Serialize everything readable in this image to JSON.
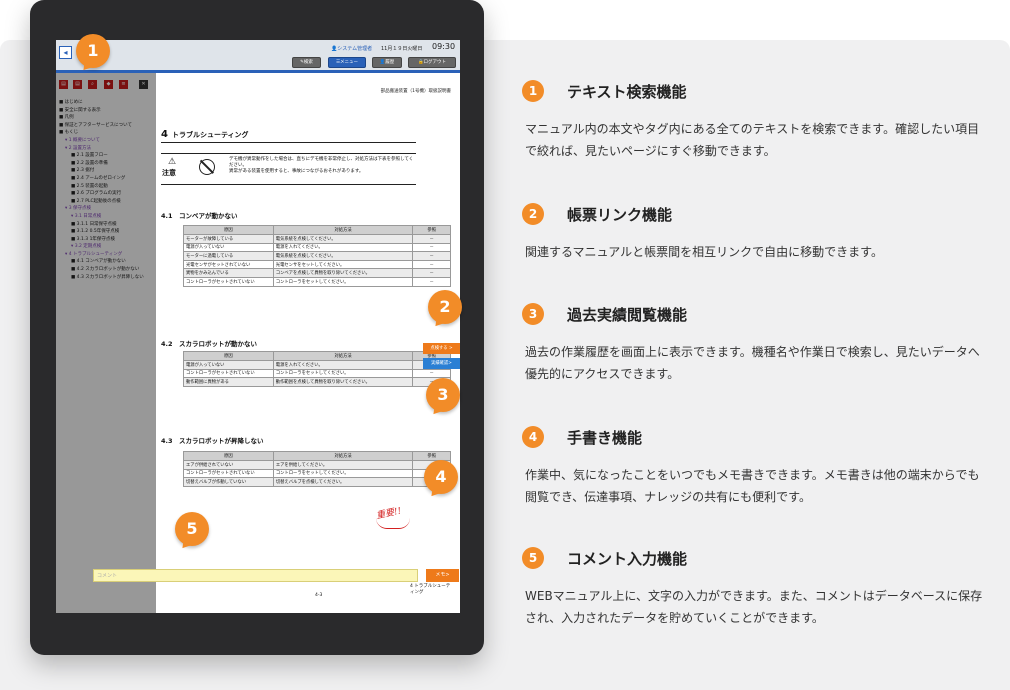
{
  "app": {
    "user": "システム管理者",
    "date": "11月１９日火曜日",
    "time": "09:30",
    "buttons": [
      "検索",
      "メニュー",
      "履歴",
      "ログアウト"
    ]
  },
  "sidebar": {
    "tools": [
      "document-icon",
      "document-icon",
      "search-icon",
      "tag-icon",
      "list-icon",
      "close-icon"
    ],
    "nav": [
      {
        "label": "はじめに",
        "level": 1,
        "purple": false
      },
      {
        "label": "安全に関する表示",
        "level": 1,
        "purple": false
      },
      {
        "label": "凡例",
        "level": 1,
        "purple": false
      },
      {
        "label": "保証とアフターサービスについて",
        "level": 1,
        "purple": false
      },
      {
        "label": "もくじ",
        "level": 1,
        "purple": false
      },
      {
        "label": "1 概要について",
        "level": 2,
        "purple": true
      },
      {
        "label": "2 設置方法",
        "level": 2,
        "purple": true
      },
      {
        "label": "2.1 設置フロー",
        "level": 3,
        "purple": false
      },
      {
        "label": "2.2 設置の準備",
        "level": 3,
        "purple": false
      },
      {
        "label": "2.3 据付",
        "level": 3,
        "purple": false
      },
      {
        "label": "2.4 アームのゼロイング",
        "level": 3,
        "purple": false
      },
      {
        "label": "2.5 装置の起動",
        "level": 3,
        "purple": false
      },
      {
        "label": "2.6 プログラムの実行",
        "level": 3,
        "purple": false
      },
      {
        "label": "2.7 PLC起動後の点検",
        "level": 3,
        "purple": false
      },
      {
        "label": "3 保守点検",
        "level": 2,
        "purple": true
      },
      {
        "label": "3.1 日常点検",
        "level": 3,
        "purple": true
      },
      {
        "label": "3.1.1 日常保守点検",
        "level": 3,
        "purple": false
      },
      {
        "label": "3.1.2 0.5年保守点検",
        "level": 3,
        "purple": false
      },
      {
        "label": "3.1.3 1年保守点検",
        "level": 3,
        "purple": false
      },
      {
        "label": "3.2 定期点検",
        "level": 3,
        "purple": true
      },
      {
        "label": "4 トラブルシューティング",
        "level": 2,
        "purple": true
      },
      {
        "label": "4.1 コンベアが動かない",
        "level": 3,
        "purple": false
      },
      {
        "label": "4.2 スカラロボットが動かない",
        "level": 3,
        "purple": false
      },
      {
        "label": "4.3 スカラロボットが昇降しない",
        "level": 3,
        "purple": false
      }
    ]
  },
  "doc": {
    "header": "部品搬送装置（1号機）取扱説明書",
    "chapter_num": "4",
    "chapter_title": "トラブルシューティング",
    "warning_label": "注意",
    "warning_text": "デモ機が異常動作をした場合は、直ちにデモ機を非常停止し、対処方法は下表を参照してください。\n異常がある装置を使用すると、事故につながるおそれがあります。",
    "sections": [
      {
        "title": "4.1　コンベアが動かない",
        "headers": [
          "原因",
          "対処方法",
          "参照"
        ],
        "rows": [
          [
            "モーターが故障している",
            "電気系統を点検してください。",
            "－"
          ],
          [
            "電源が入っていない",
            "電源を入れてください。",
            "－"
          ],
          [
            "モーターに過電している",
            "電気系統を点検してください。",
            "－"
          ],
          [
            "光電センサがセットされていない",
            "光電センサをセットしてください。",
            "－"
          ],
          [
            "異物をかみ込んでいる",
            "コンベアを点検して異物を取り除いてください。",
            "－"
          ],
          [
            "コントローラがセットされていない",
            "コントローラをセットしてください。",
            "－"
          ]
        ]
      },
      {
        "title": "4.2　スカラロボットが動かない",
        "headers": [
          "原因",
          "対処方法",
          "参照"
        ],
        "rows": [
          [
            "電源が入っていない",
            "電源を入れてください。",
            "－"
          ],
          [
            "コントローラがセットされていない",
            "コントローラをセットしてください。",
            "－"
          ],
          [
            "動作範囲に異物がある",
            "動作範囲を点検して異物を取り除いてください。",
            "－"
          ]
        ]
      },
      {
        "title": "4.3　スカラロボットが昇降しない",
        "headers": [
          "原因",
          "対処方法",
          "参照"
        ],
        "rows": [
          [
            "エアが供給されていない",
            "エアを供給してください。",
            "－"
          ],
          [
            "コントローラがセットされていない",
            "コントローラをセットしてください。",
            "－"
          ],
          [
            "切替えバルブが作動していない",
            "切替えバルブを点検してください。",
            "－"
          ]
        ]
      }
    ],
    "footer_right": "4 トラブルシューティング",
    "footer_page": "4-3",
    "comment_placeholder": "コメント",
    "memo_button": "メモ>",
    "side_btn_1": "点検する >",
    "side_btn_2": "実績確認>",
    "handwritten": "重要!!"
  },
  "badges": [
    "1",
    "2",
    "3",
    "4",
    "5"
  ],
  "features": [
    {
      "num": "1",
      "title": "テキスト検索機能",
      "desc": "マニュアル内の本文やタグ内にある全てのテキストを検索できます。確認したい項目で絞れば、見たいページにすぐ移動できます。"
    },
    {
      "num": "2",
      "title": "帳票リンク機能",
      "desc": "関連するマニュアルと帳票間を相互リンクで自由に移動できます。"
    },
    {
      "num": "3",
      "title": "過去実績閲覧機能",
      "desc": "過去の作業履歴を画面上に表示できます。機種名や作業日で検索し、見たいデータへ優先的にアクセスできます。"
    },
    {
      "num": "4",
      "title": "手書き機能",
      "desc": "作業中、気になったことをいつでもメモ書きできます。メモ書きは他の端末からでも閲覧でき、伝達事項、ナレッジの共有にも便利です。"
    },
    {
      "num": "5",
      "title": "コメント入力機能",
      "desc": "WEBマニュアル上に、文字の入力ができます。また、コメントはデータベースに保存され、入力されたデータを貯めていくことができます。"
    }
  ],
  "colors": {
    "accent": "#f28c28",
    "brand_blue": "#2a61b8",
    "alert_red": "#c61b1b",
    "comment_yellow": "#fbf6b8"
  }
}
